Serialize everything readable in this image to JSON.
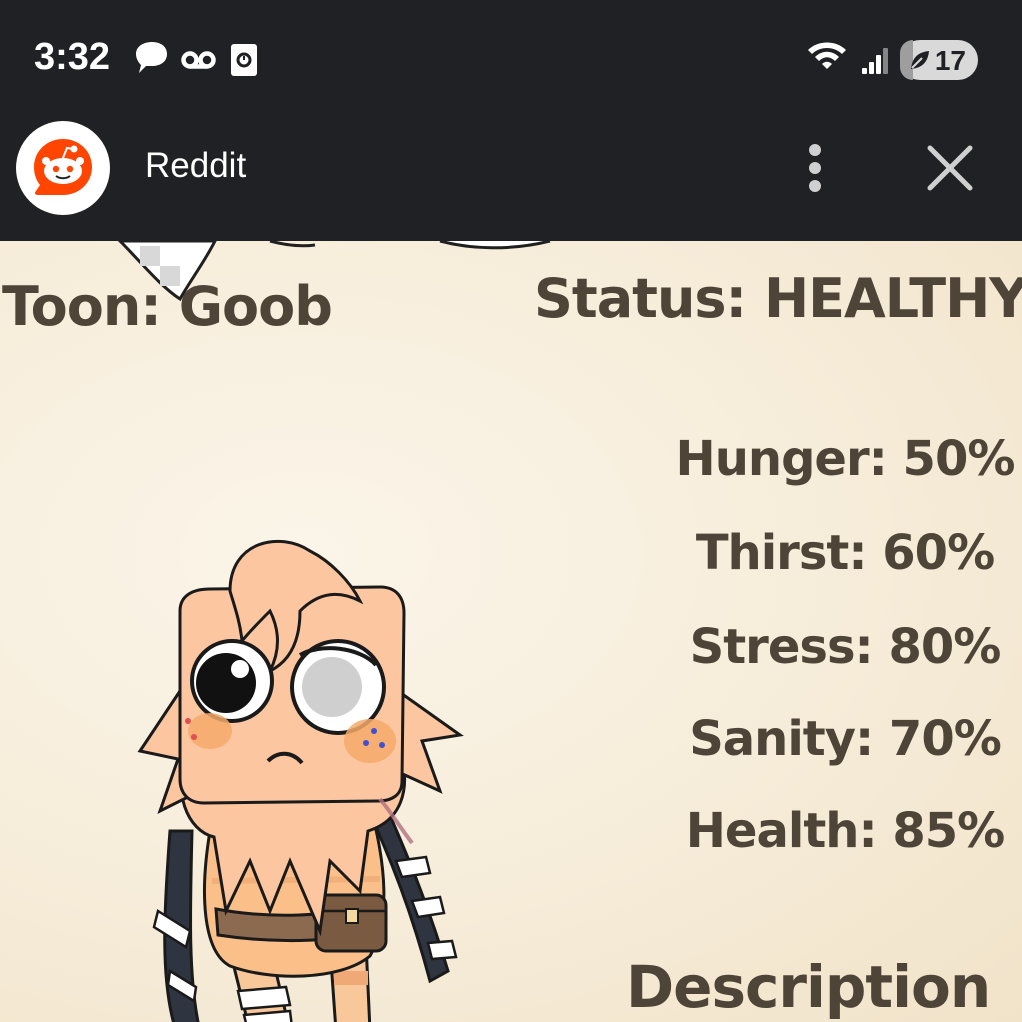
{
  "status_bar": {
    "time": "3:32",
    "left_icons": [
      "chat-bubble-icon",
      "voicemail-icon",
      "screenshot-icon"
    ],
    "right_icons": [
      "wifi-icon",
      "signal-icon"
    ],
    "battery_level": "17",
    "battery_fraction": 0.17
  },
  "app_header": {
    "title": "Reddit",
    "logo": "reddit-logo",
    "menu_icon": "more-vert-icon",
    "close_icon": "close-icon"
  },
  "card": {
    "toon_label": "Toon: Goob",
    "status_label": "Status: HEALTHY",
    "stats": [
      {
        "text": "Hunger: 50%"
      },
      {
        "text": "Thirst: 60%"
      },
      {
        "text": "Stress: 80%"
      },
      {
        "text": "Sanity: 70%"
      },
      {
        "text": "Health: 85%"
      }
    ],
    "description_label": "Description"
  },
  "colors": {
    "topbar": "#202124",
    "paper": "#f6ecd9",
    "text": "#4e4538",
    "reddit_orange": "#ff4500"
  }
}
